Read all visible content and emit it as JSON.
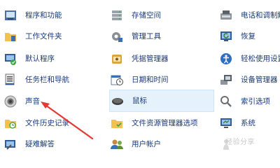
{
  "control_panel": {
    "top_partial": "ଛ",
    "col1": [
      {
        "label": "程序和功能",
        "icon": "programs-features-icon"
      },
      {
        "label": "工作文件夹",
        "icon": "work-folders-icon"
      },
      {
        "label": "默认程序",
        "icon": "default-programs-icon"
      },
      {
        "label": "任务栏和导航",
        "icon": "taskbar-navigation-icon"
      },
      {
        "label": "声音",
        "icon": "sound-speaker-icon"
      },
      {
        "label": "文件历史记录",
        "icon": "file-history-icon"
      },
      {
        "label": "疑难解答",
        "icon": "troubleshooting-icon"
      }
    ],
    "col2": [
      {
        "label": "存储空间",
        "icon": "storage-spaces-icon"
      },
      {
        "label": "管理工具",
        "icon": "admin-tools-icon"
      },
      {
        "label": "凭据管理器",
        "icon": "credential-manager-icon"
      },
      {
        "label": "日期和时间",
        "icon": "date-time-icon"
      },
      {
        "label": "鼠标",
        "icon": "mouse-icon"
      },
      {
        "label": "文件资源管理器选项",
        "icon": "explorer-options-icon"
      },
      {
        "label": "用户帐户",
        "icon": "user-accounts-icon"
      }
    ],
    "col3": [
      {
        "label": "电话和调制解",
        "icon": "phone-modem-icon"
      },
      {
        "label": "恢复",
        "icon": "recovery-icon"
      },
      {
        "label": "轻松使用设置",
        "icon": "ease-of-access-icon"
      },
      {
        "label": "设备管理器",
        "icon": "device-manager-icon"
      },
      {
        "label": "索引选项",
        "icon": "indexing-options-icon"
      },
      {
        "label": "系统",
        "icon": "system-icon"
      },
      {
        "label": "",
        "icon": "fonts-icon"
      }
    ]
  },
  "watermark": "经验分享",
  "colors": {
    "label": "#1a3a7a",
    "highlight": "#e6f2fb",
    "arrow": "#e53935"
  }
}
